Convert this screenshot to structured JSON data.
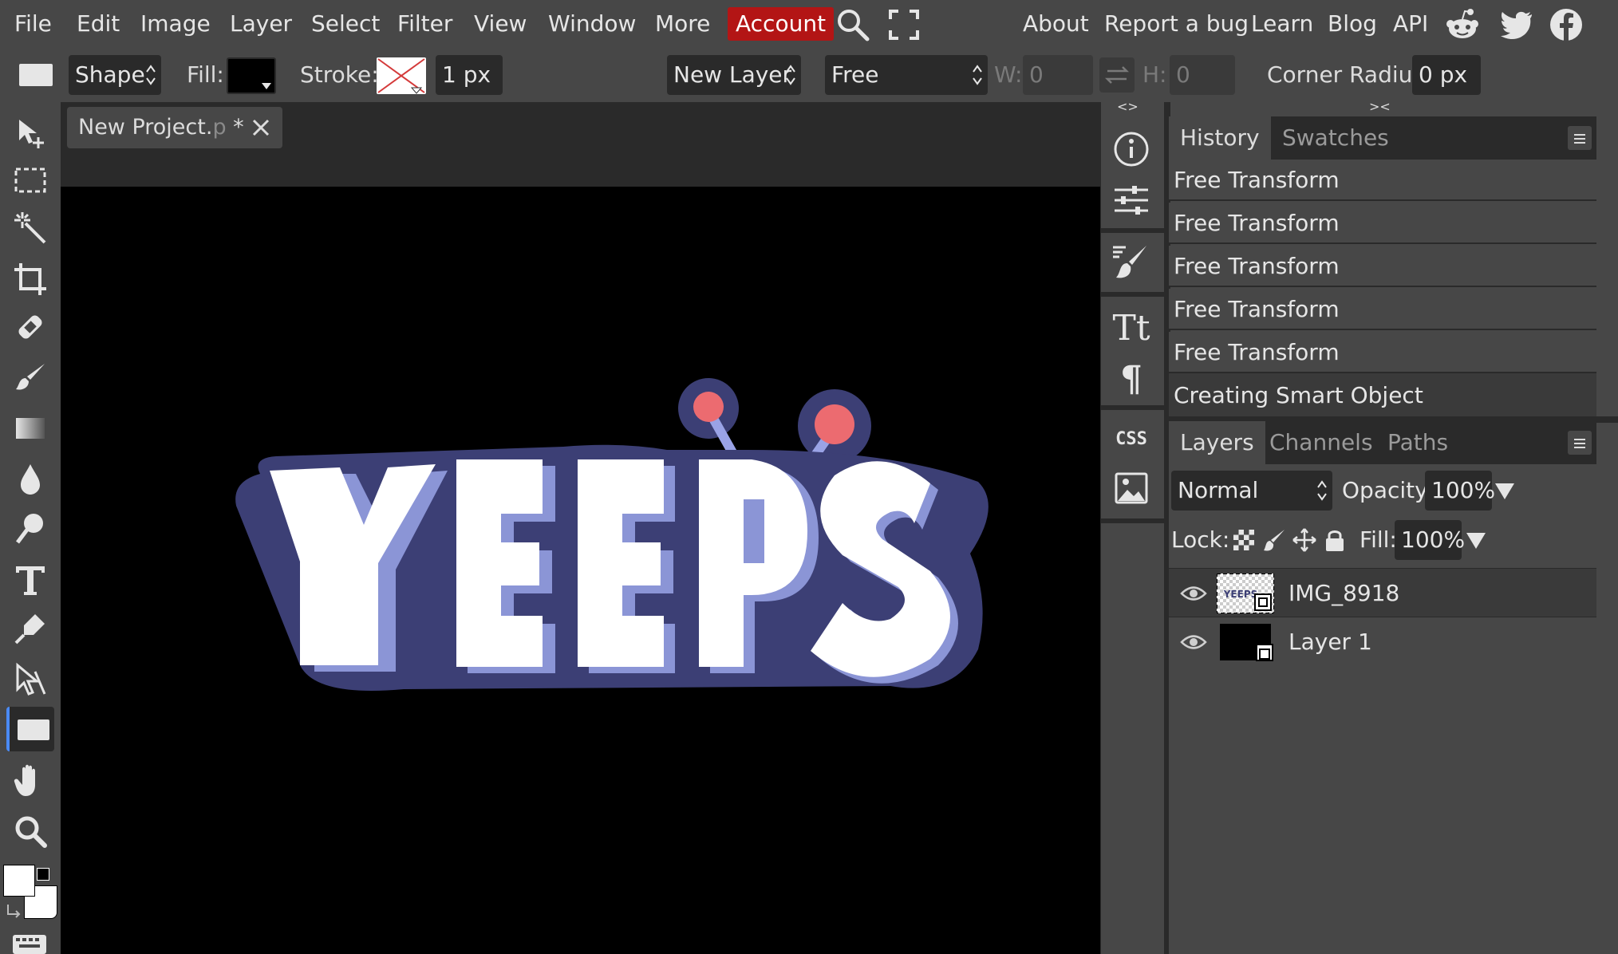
{
  "menubar": {
    "items": [
      "File",
      "Edit",
      "Image",
      "Layer",
      "Select",
      "Filter",
      "View",
      "Window",
      "More",
      "Account"
    ],
    "right_links": [
      "About",
      "Report a bug",
      "Learn",
      "Blog",
      "API"
    ],
    "social_icons": [
      "reddit-icon",
      "twitter-icon",
      "facebook-icon"
    ]
  },
  "options": {
    "mode": "Shape",
    "fill_label": "Fill:",
    "fill_color": "#000000",
    "stroke_label": "Stroke:",
    "stroke_width": "1 px",
    "target": "New Layer",
    "constraint": "Free",
    "w_label": "W:",
    "w_value": "0",
    "h_label": "H:",
    "h_value": "0",
    "corner_label": "Corner Radius:",
    "corner_value": "0 px"
  },
  "document": {
    "tab_name": "New Project.",
    "tab_ext": "p",
    "tab_modified": "*",
    "canvas_art_text": "YEEPS"
  },
  "history": {
    "tabs": [
      "History",
      "Swatches"
    ],
    "items": [
      "Free Transform",
      "Free Transform",
      "Free Transform",
      "Free Transform",
      "Free Transform",
      "Creating Smart Object"
    ]
  },
  "layers": {
    "tabs": [
      "Layers",
      "Channels",
      "Paths"
    ],
    "blend_mode": "Normal",
    "opacity_label": "Opacity:",
    "opacity": "100%",
    "lock_label": "Lock:",
    "fill_label": "Fill:",
    "fill": "100%",
    "items": [
      {
        "name": "IMG_8918",
        "selected": true
      },
      {
        "name": "Layer 1",
        "selected": false
      }
    ]
  },
  "colors": {
    "accent": "#4a8af4",
    "account": "#b31515",
    "foreground": "#ffffff",
    "background": "#ffffff"
  },
  "icon_strip": [
    "info-icon",
    "adjustments-icon",
    "brush-settings-icon",
    "character-icon",
    "paragraph-icon",
    "css-icon",
    "image-icon"
  ],
  "strip_css_label": "CSS"
}
